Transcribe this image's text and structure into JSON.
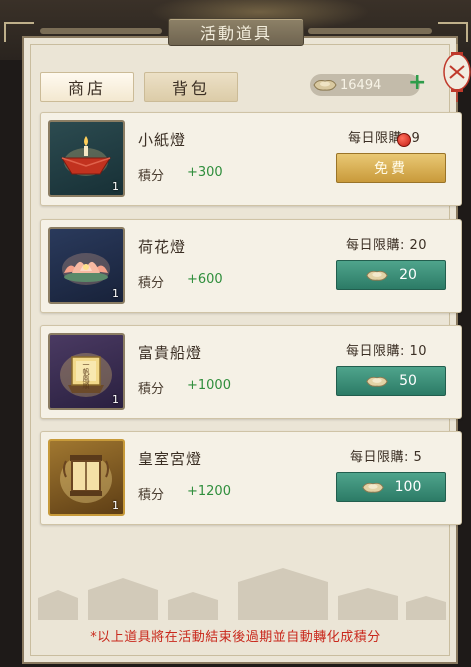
{
  "title": "活動道具",
  "tabs": [
    {
      "label": "商店",
      "active": true
    },
    {
      "label": "背包",
      "active": false
    }
  ],
  "currency": {
    "amount": "16494",
    "icon": "gold-ingot-icon",
    "plus_icon": "plus-icon"
  },
  "items": [
    {
      "name": "小紙燈",
      "points_label": "積分",
      "points": "+300",
      "limit": "每日限購: 9",
      "count": "1",
      "button_label": "免費",
      "button_type": "free",
      "icon": "paper-boat-lantern-icon"
    },
    {
      "name": "荷花燈",
      "points_label": "積分",
      "points": "+600",
      "limit": "每日限購: 20",
      "count": "1",
      "button_label": "20",
      "button_type": "paid",
      "icon": "lotus-lantern-icon"
    },
    {
      "name": "富貴船燈",
      "points_label": "積分",
      "points": "+1000",
      "limit": "每日限購: 10",
      "count": "1",
      "button_label": "50",
      "button_type": "paid",
      "icon": "boat-lantern-icon",
      "icon_text": "一帆風順"
    },
    {
      "name": "皇室宮燈",
      "points_label": "積分",
      "points": "+1200",
      "limit": "每日限購: 5",
      "count": "1",
      "button_label": "100",
      "button_type": "paid",
      "icon": "palace-lantern-icon"
    }
  ],
  "footer_note": "*以上道具將在活動結束後過期並自動轉化成積分",
  "colors": {
    "panel_bg": "#ebe5d6",
    "paid_button": "#2c7b66",
    "free_button": "#c99a3b",
    "points_green": "#2f8e3c",
    "notice_red": "#c9281c"
  }
}
